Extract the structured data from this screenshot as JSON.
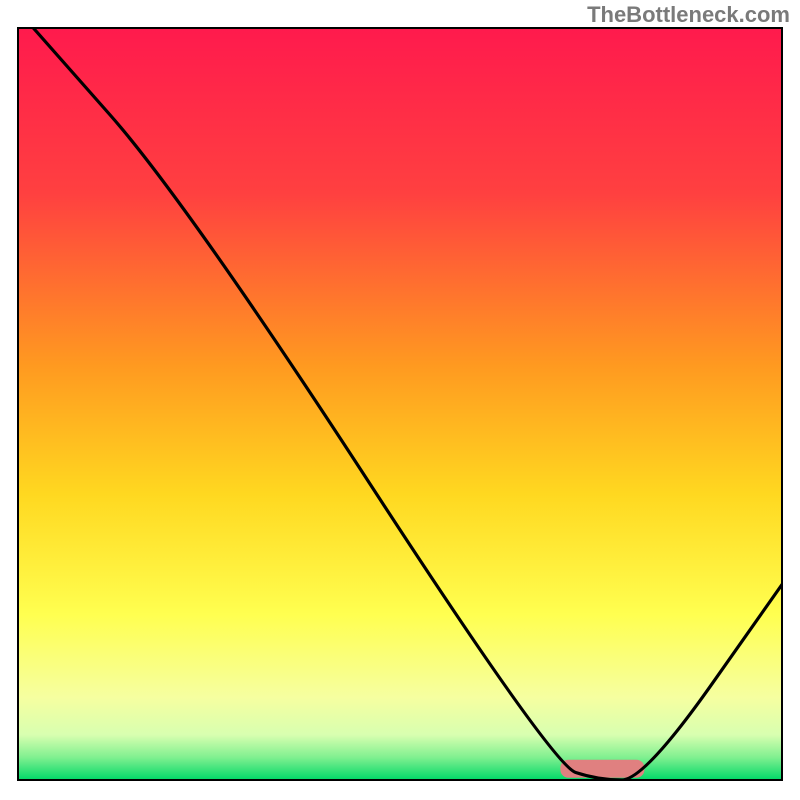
{
  "attribution": "TheBottleneck.com",
  "chart_data": {
    "type": "line",
    "title": "",
    "xlabel": "",
    "ylabel": "",
    "xlim": [
      0,
      100
    ],
    "ylim": [
      0,
      100
    ],
    "grid": false,
    "legend": false,
    "series": [
      {
        "name": "bottleneck-curve",
        "color": "#000000",
        "points": [
          {
            "x": 2,
            "y": 100
          },
          {
            "x": 22,
            "y": 77
          },
          {
            "x": 70,
            "y": 2
          },
          {
            "x": 76,
            "y": 0
          },
          {
            "x": 82,
            "y": 0
          },
          {
            "x": 100,
            "y": 26
          }
        ]
      }
    ],
    "marker": {
      "name": "optimal-range-marker",
      "x_start": 71,
      "x_end": 82,
      "y": 1.5,
      "color": "#e08080"
    },
    "background_gradient": {
      "top": "#ff1a4d",
      "mid_upper": "#ff8030",
      "mid": "#ffd830",
      "mid_lower": "#ffff60",
      "lower": "#f8ffb0",
      "bottom": "#00e070"
    }
  }
}
